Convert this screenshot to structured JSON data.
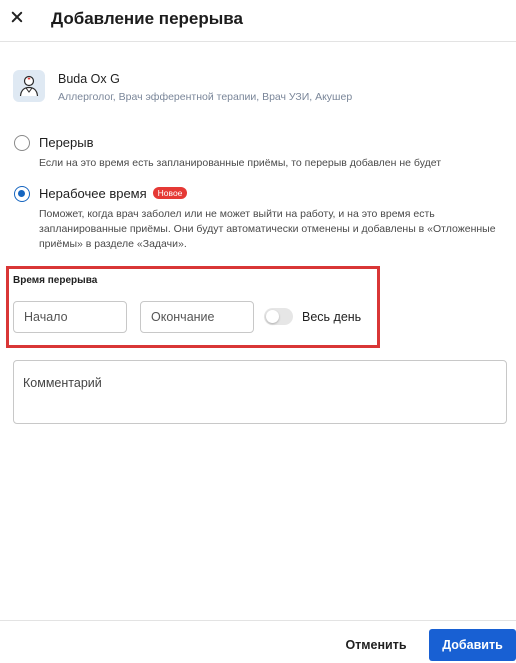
{
  "dialog": {
    "title": "Добавление перерыва"
  },
  "doctor": {
    "name": "Buda Ox G",
    "specialties": "Аллерголог, Врач эфферентной терапии, Врач УЗИ, Акушер",
    "avatar_icon": "doctor-avatar-icon"
  },
  "options": [
    {
      "label": "Перерыв",
      "description": "Если на это время есть запланированные приёмы, то перерыв добавлен не будет",
      "checked": false
    },
    {
      "label": "Нерабочее время",
      "badge": "Новое",
      "description": "Поможет, когда врач заболел или не может выйти на работу, и на это время есть запланированные приёмы. Они будут автоматически отменены и добавлены в «Отложенные приёмы» в разделе «Задачи».",
      "checked": true
    }
  ],
  "break_time": {
    "title": "Время перерыва",
    "start_placeholder": "Начало",
    "end_placeholder": "Окончание",
    "all_day_label": "Весь день",
    "all_day_enabled": false
  },
  "comment": {
    "placeholder": "Комментарий"
  },
  "footer": {
    "cancel_label": "Отменить",
    "add_label": "Добавить"
  },
  "colors": {
    "accent": "#1860d3",
    "badge": "#e53935",
    "highlight": "#d93636"
  }
}
